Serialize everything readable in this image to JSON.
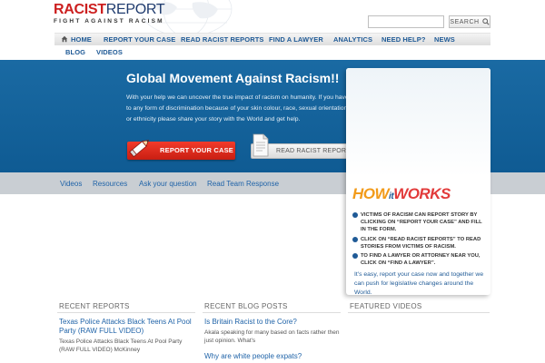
{
  "logo": {
    "racist": "RACIST",
    "report": "REPORT",
    "tagline": "FIGHT AGAINST RACISM"
  },
  "search": {
    "placeholder": "",
    "button_label": "SEARCH"
  },
  "nav": {
    "items": [
      "HOME",
      "REPORT YOUR CASE",
      "READ RACIST REPORTS",
      "FIND A LAWYER",
      "ANALYTICS",
      "NEED HELP?",
      "NEWS"
    ],
    "items_row2": [
      "BLOG",
      "VIDEOS"
    ]
  },
  "hero": {
    "title": "Global Movement Against Racism!!",
    "text": "With your help we can uncover the true impact of racism on humanity. If you have been subjected to any form of discrimination because of your skin colour, race, sexual orientation, religion, culture or ethnicity please share your story with the World and get help.",
    "report_button": "REPORT YOUR CASE",
    "read_button": "READ RACIST REPORTS"
  },
  "subnav": [
    "Videos",
    "Resources",
    "Ask your question",
    "Read Team Response"
  ],
  "how_it_works": {
    "title_how": "HOW",
    "title_it": "it",
    "title_works": "WORKS",
    "steps": [
      "VICTIMS OF RACISM CAN REPORT STORY BY CLICKING ON “REPORT YOUR CASE” AND FILL IN THE FORM.",
      "CLICK ON “READ RACIST REPORTS” TO READ STORIES FROM VICTIMS OF RACISM.",
      "TO FIND A LAWYER OR ATTORNEY NEAR YOU, CLICK ON “FIND A LAWYER”."
    ],
    "note": "It's easy, report your case now and together we can push for legislative changes around the World."
  },
  "columns": {
    "recent_reports": {
      "heading": "RECENT REPORTS",
      "post_title": "Texas Police Attacks Black Teens At Pool Party (RAW FULL VIDEO)",
      "post_excerpt": "Texas Police Attacks Black Teens At Pool Party (RAW FULL VIDEO) McKinney"
    },
    "recent_blog": {
      "heading": "RECENT BLOG POSTS",
      "post1_title": "Is Britain Racist to the Core?",
      "post1_excerpt": "Akala speaking for many based on facts rather then just opinion. What's",
      "post2_title": "Why are white people expats?"
    },
    "featured_videos": {
      "heading": "FEATURED VIDEOS"
    }
  },
  "colors": {
    "brand_red": "#cc1f1f",
    "brand_blue": "#1f5a96",
    "hero_blue": "#1a6aa3",
    "link_blue": "#1f63a8"
  }
}
